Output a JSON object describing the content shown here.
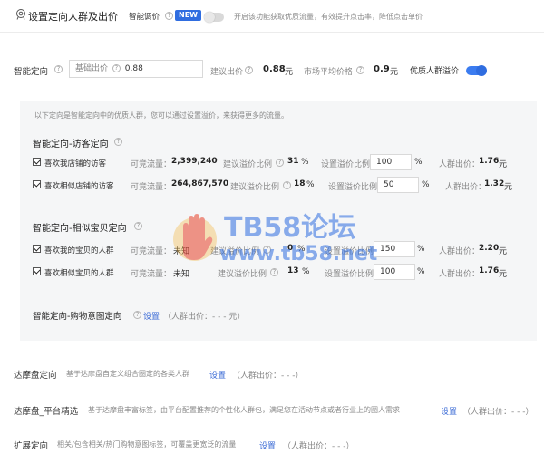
{
  "header": {
    "title": "设置定向人群及出价",
    "smart_bid_label": "智能调价",
    "new_badge": "NEW",
    "smart_bid_desc": "开启该功能获取优质流量，有效提升点击率，降低点击单价"
  },
  "smart": {
    "label": "智能定向",
    "base_bid_label": "基础出价",
    "base_bid_value": "0.88",
    "suggest_label": "建议出价",
    "suggest_value": "0.88",
    "suggest_unit": "元",
    "market_label": "市场平均价格",
    "market_value": "0.9",
    "market_unit": "元",
    "premium_label": "优质人群溢价"
  },
  "panel": {
    "intro": "以下定向是智能定向中的优质人群，您可以通过设置溢价，来获得更多的流量。",
    "groups": [
      {
        "title": "智能定向-访客定向",
        "rows": [
          {
            "name": "喜欢我店铺的访客",
            "traffic_label": "可竞流量：",
            "traffic": "2,399,240",
            "ratio_label": "建议溢价比例",
            "ratio": "31",
            "pct": "%",
            "set_label": "设置溢价比例",
            "value": "100",
            "value_pct": "%",
            "bid_label": "人群出价：",
            "bid": "1.76",
            "bid_unit": "元"
          },
          {
            "name": "喜欢相似店铺的访客",
            "traffic_label": "可竞流量：",
            "traffic": "264,867,570",
            "ratio_label": "建议溢价比例",
            "ratio": "18",
            "pct": "%",
            "set_label": "设置溢价比例",
            "value": "50",
            "value_pct": "%",
            "bid_label": "人群出价：",
            "bid": "1.32",
            "bid_unit": "元"
          }
        ]
      },
      {
        "title": "智能定向-相似宝贝定向",
        "rows": [
          {
            "name": "喜欢我的宝贝的人群",
            "traffic_label": "可竞流量：",
            "traffic": "未知",
            "ratio_label": "建议溢价比例",
            "ratio": "0",
            "pct": "%",
            "set_label": "设置溢价比例",
            "value": "150",
            "value_pct": "%",
            "bid_label": "人群出价：",
            "bid": "2.20",
            "bid_unit": "元"
          },
          {
            "name": "喜欢相似宝贝的人群",
            "traffic_label": "可竞流量：",
            "traffic": "未知",
            "ratio_label": "建议溢价比例",
            "ratio": "13",
            "pct": "%",
            "set_label": "设置溢价比例",
            "value": "100",
            "value_pct": "%",
            "bid_label": "人群出价：",
            "bid": "1.76",
            "bid_unit": "元"
          }
        ]
      }
    ],
    "shopping": {
      "title": "智能定向-购物意图定向",
      "setting": "设置",
      "bid": "（人群出价：- - - 元）"
    }
  },
  "bottom": [
    {
      "title": "达摩盘定向",
      "desc": "基于达摩盘自定义组合圈定的各类人群",
      "setting": "设置",
      "bid": "（人群出价：- - -）"
    },
    {
      "title": "达摩盘_平台精选",
      "desc": "基于达摩盘丰富标签，由平台配置推荐的个性化人群包，满足您在活动节点或者行业上的圈人需求",
      "setting": "设置",
      "bid": "（人群出价：- - -）"
    },
    {
      "title": "扩展定向",
      "desc": "相关/包含相关/热门购物意图标签，可覆盖更宽泛的流量",
      "setting": "设置",
      "bid": "（人群出价：- - -）"
    }
  ],
  "watermark": {
    "brand": "TB58论坛",
    "url": "www.tb58.net"
  },
  "colors": {
    "accent": "#2f6de0",
    "panel_bg": "#f5f6f7"
  },
  "icons": [
    "target-icon",
    "question-icon",
    "checkbox-icon",
    "hand-logo-icon"
  ]
}
